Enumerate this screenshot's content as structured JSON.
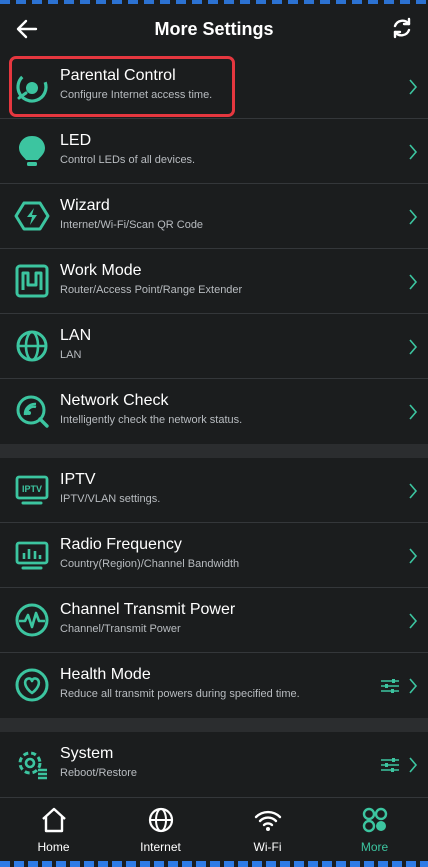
{
  "header": {
    "title": "More Settings",
    "back_icon": "arrow-left-icon",
    "refresh_icon": "refresh-icon"
  },
  "groups": [
    {
      "items": [
        {
          "title": "Parental Control",
          "subtitle": "Configure Internet access time.",
          "icon": "parental-control-icon",
          "highlighted": true
        },
        {
          "title": "LED",
          "subtitle": "Control LEDs of all devices.",
          "icon": "bulb-icon"
        },
        {
          "title": "Wizard",
          "subtitle": "Internet/Wi-Fi/Scan QR Code",
          "icon": "wizard-bolt-icon"
        },
        {
          "title": "Work Mode",
          "subtitle": "Router/Access Point/Range Extender",
          "icon": "work-mode-icon"
        },
        {
          "title": "LAN",
          "subtitle": "LAN",
          "icon": "globe-icon"
        },
        {
          "title": "Network Check",
          "subtitle": "Intelligently check the network status.",
          "icon": "network-check-icon"
        }
      ]
    },
    {
      "items": [
        {
          "title": "IPTV",
          "subtitle": "IPTV/VLAN settings.",
          "icon": "iptv-icon",
          "icon_text": "IPTV"
        },
        {
          "title": "Radio Frequency",
          "subtitle": "Country(Region)/Channel Bandwidth",
          "icon": "radio-frequency-icon"
        },
        {
          "title": "Channel Transmit Power",
          "subtitle": "Channel/Transmit Power",
          "icon": "transmit-power-icon"
        },
        {
          "title": "Health Mode",
          "subtitle": "Reduce all transmit powers during specified time.",
          "icon": "health-heart-icon",
          "has_sliders": true
        }
      ]
    },
    {
      "items": [
        {
          "title": "System",
          "subtitle": "Reboot/Restore",
          "icon": "system-gear-icon",
          "has_sliders": true
        }
      ]
    }
  ],
  "tabs": [
    {
      "label": "Home",
      "icon": "home-icon",
      "active": false
    },
    {
      "label": "Internet",
      "icon": "globe-icon",
      "active": false
    },
    {
      "label": "Wi-Fi",
      "icon": "wifi-icon",
      "active": false
    },
    {
      "label": "More",
      "icon": "more-icon",
      "active": true
    }
  ],
  "colors": {
    "background": "#1b1d1e",
    "accent": "#3cc5a0",
    "highlight": "#e5373f",
    "separator": "#2b2d2f"
  }
}
